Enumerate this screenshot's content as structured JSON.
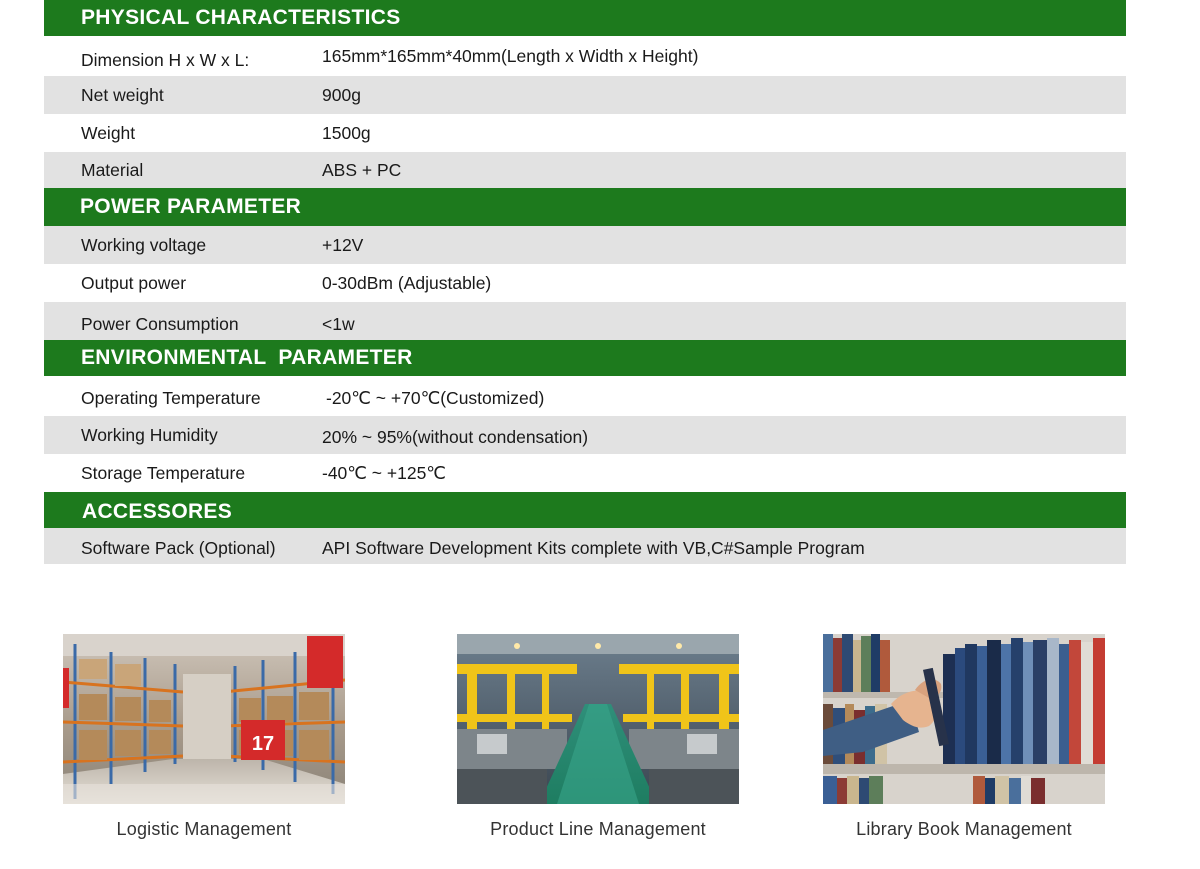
{
  "sections": [
    {
      "title": "PHYSICAL CHARACTERISTICS",
      "rows": [
        {
          "label": "Dimension H x W x L:",
          "value": "165mm*165mm*40mm(Length x Width x Height)"
        },
        {
          "label": "Net weight",
          "value": "900g"
        },
        {
          "label": "Weight",
          "value": "1500g"
        },
        {
          "label": "Material",
          "value": "ABS + PC"
        }
      ]
    },
    {
      "title": "POWER PARAMETER",
      "rows": [
        {
          "label": "Working voltage",
          "value": "+12V"
        },
        {
          "label": "Output power",
          "value": "0-30dBm (Adjustable)"
        },
        {
          "label": "Power Consumption",
          "value": "<1w"
        }
      ]
    },
    {
      "title": "ENVIRONMENTAL  PARAMETER",
      "rows": [
        {
          "label": "Operating Temperature",
          "value": "-20℃ ~ +70℃(Customized)"
        },
        {
          "label": "Working Humidity",
          "value": "20% ~ 95%(without condensation)"
        },
        {
          "label": "Storage Temperature",
          "value": "-40℃ ~ +125℃"
        }
      ]
    },
    {
      "title": "ACCESSORES",
      "rows": [
        {
          "label": "Software Pack (Optional)",
          "value": "API Software Development Kits complete with VB,C#Sample Program"
        }
      ]
    }
  ],
  "gallery": [
    {
      "caption": "Logistic Management",
      "image": "warehouse-shelves-photo",
      "sign_text": "17"
    },
    {
      "caption": "Product Line Management",
      "image": "factory-production-line-photo"
    },
    {
      "caption": "Library Book Management",
      "image": "library-bookshelf-photo"
    }
  ],
  "colors": {
    "section_header": "#1d7a1d",
    "row_alt": "#e2e2e2",
    "row_plain": "#ffffff"
  }
}
